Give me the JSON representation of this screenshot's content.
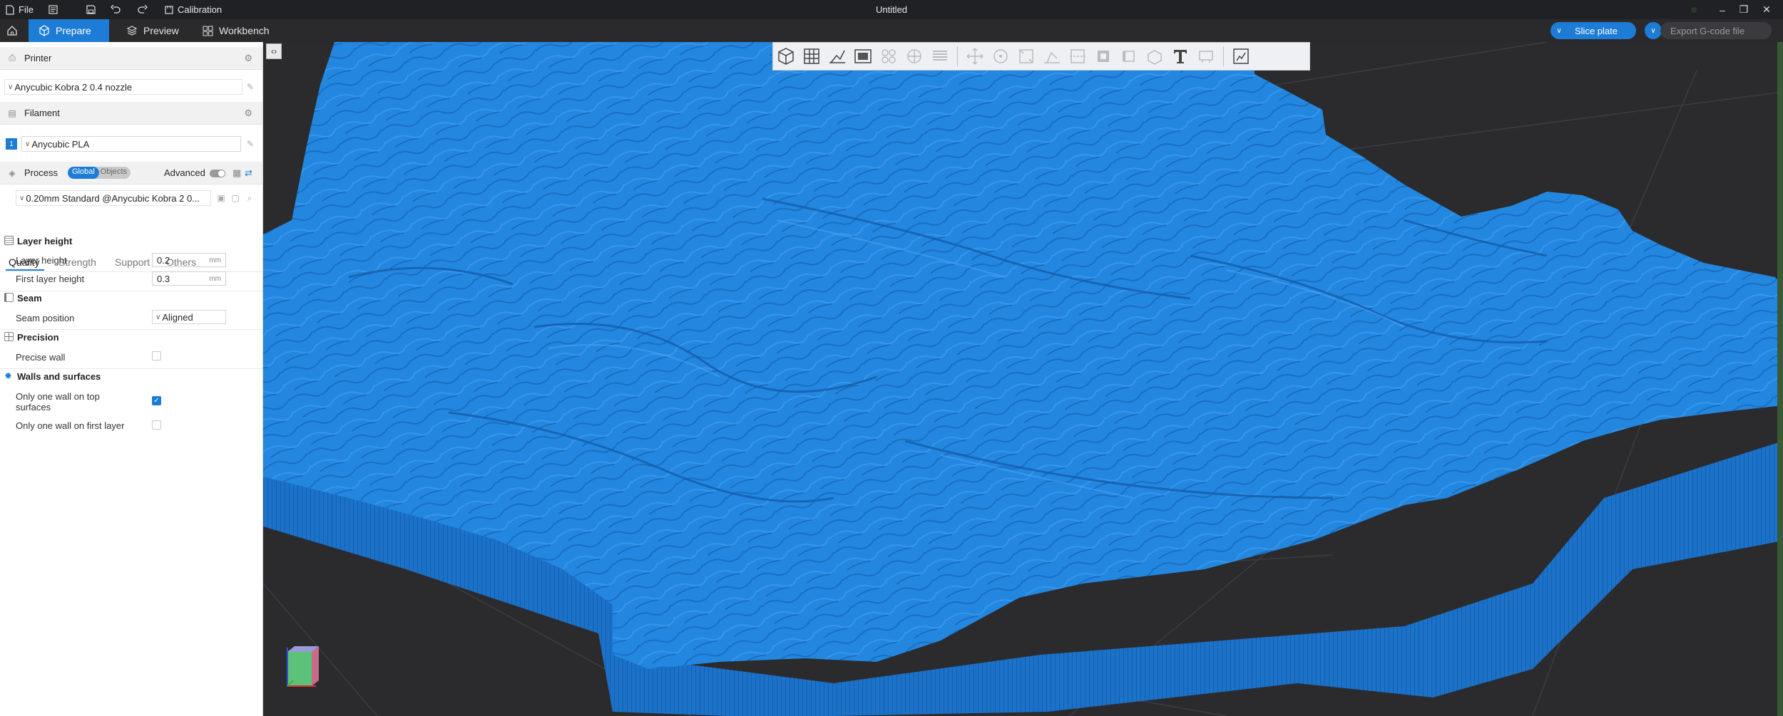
{
  "titlebar": {
    "file_label": "File",
    "calibration_label": "Calibration",
    "window_title": "Untitled"
  },
  "tabs": {
    "prepare": "Prepare",
    "preview": "Preview",
    "workbench": "Workbench"
  },
  "actions": {
    "slice": "Slice plate",
    "export": "Export G-code file"
  },
  "printer": {
    "heading": "Printer",
    "selected": "Anycubic Kobra 2 0.4 nozzle"
  },
  "filament": {
    "heading": "Filament",
    "slot_number": "1",
    "selected": "Anycubic PLA"
  },
  "process": {
    "heading": "Process",
    "scope_global": "Global",
    "scope_objects": "Objects",
    "advanced_label": "Advanced",
    "advanced_on": false,
    "preset": "0.20mm Standard @Anycubic Kobra 2 0..."
  },
  "subtabs": {
    "quality": "Quality",
    "strength": "Strength",
    "support": "Support",
    "others": "Others",
    "active": "Quality"
  },
  "quality": {
    "layer_height_group": "Layer height",
    "layer_height_label": "Layer height",
    "layer_height_value": "0.2",
    "first_layer_height_label": "First layer height",
    "first_layer_height_value": "0.3",
    "unit": "mm",
    "seam_group": "Seam",
    "seam_position_label": "Seam position",
    "seam_position_value": "Aligned",
    "precision_group": "Precision",
    "precise_wall_label": "Precise wall",
    "precise_wall_checked": false,
    "walls_group": "Walls and surfaces",
    "one_wall_top_label": "Only one wall on top surfaces",
    "one_wall_top_checked": true,
    "one_wall_first_label": "Only one wall on first layer",
    "one_wall_first_checked": false
  },
  "icons": {
    "home": "home-icon",
    "save": "save-icon",
    "undo": "undo-icon",
    "redo": "redo-icon",
    "viewport_tools": [
      "add-object-icon",
      "arrange-grid-icon",
      "orient-icon",
      "plate-icon",
      "cut-icon",
      "split-icon",
      "layers-icon",
      "move-icon",
      "rotate-icon",
      "scale-icon",
      "lay-flat-icon",
      "cut-tool-icon",
      "support-paint-icon",
      "seam-paint-icon",
      "measure-icon",
      "text-icon",
      "assembly-icon",
      "slice-view-icon"
    ]
  },
  "colors": {
    "accent": "#1d7cd6",
    "model": "#1f7fd8",
    "viewport_bg": "#2b2b2e",
    "titlebar_bg": "#202124"
  }
}
